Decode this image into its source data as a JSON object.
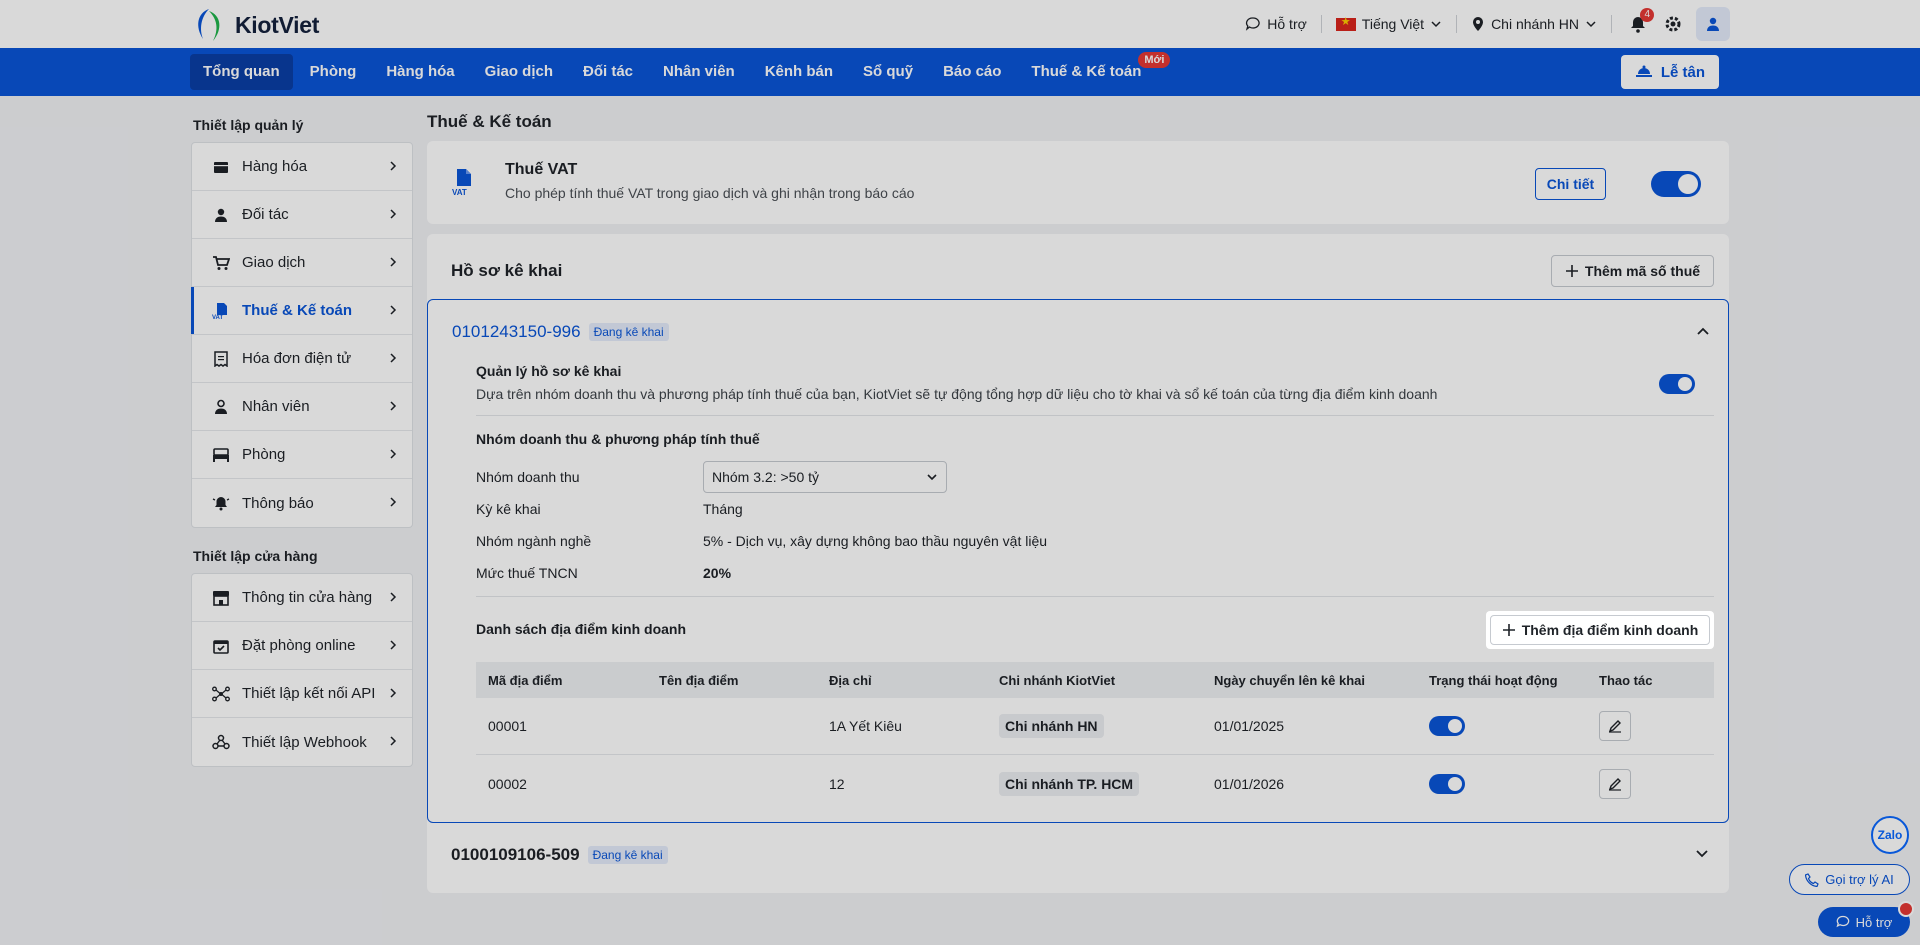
{
  "brand": {
    "name": "KiotViet"
  },
  "topbar": {
    "help": "Hỗ trợ",
    "language": "Tiếng Việt",
    "branch": "Chi nhánh HN",
    "notifications": "4"
  },
  "nav": {
    "items": [
      {
        "label": "Tổng quan",
        "active": true
      },
      {
        "label": "Phòng"
      },
      {
        "label": "Hàng hóa"
      },
      {
        "label": "Giao dịch"
      },
      {
        "label": "Đối tác"
      },
      {
        "label": "Nhân viên"
      },
      {
        "label": "Kênh bán"
      },
      {
        "label": "Sổ quỹ"
      },
      {
        "label": "Báo cáo"
      },
      {
        "label": "Thuế & Kế toán",
        "badge": "Mới"
      }
    ],
    "reception": "Lễ tân"
  },
  "sidebar": {
    "group1_title": "Thiết lập quản lý",
    "group1": [
      {
        "label": "Hàng hóa",
        "icon": "box-icon"
      },
      {
        "label": "Đối tác",
        "icon": "user-icon"
      },
      {
        "label": "Giao dịch",
        "icon": "cart-icon"
      },
      {
        "label": "Thuế & Kế toán",
        "icon": "vat-icon",
        "active": true
      },
      {
        "label": "Hóa đơn điện tử",
        "icon": "invoice-icon"
      },
      {
        "label": "Nhân viên",
        "icon": "staff-icon"
      },
      {
        "label": "Phòng",
        "icon": "bed-icon"
      },
      {
        "label": "Thông báo",
        "icon": "bell-icon"
      }
    ],
    "group2_title": "Thiết lập cửa hàng",
    "group2": [
      {
        "label": "Thông tin cửa hàng",
        "icon": "store-icon"
      },
      {
        "label": "Đặt phòng online",
        "icon": "calendar-icon"
      },
      {
        "label": "Thiết lập kết nối API",
        "icon": "api-icon"
      },
      {
        "label": "Thiết lập Webhook",
        "icon": "webhook-icon"
      }
    ]
  },
  "main": {
    "title": "Thuế & Kế toán",
    "vat": {
      "title": "Thuế VAT",
      "desc": "Cho phép tính thuế VAT trong giao dịch và ghi nhận trong báo cáo",
      "detail_btn": "Chi tiết",
      "icon_text": "VAT",
      "enabled": true
    },
    "declaration": {
      "title": "Hồ sơ kê khai",
      "add_tax_btn": "Thêm mã số thuế",
      "profile1": {
        "code": "0101243150-996",
        "status": "Đang kê khai",
        "manage_title": "Quản lý hồ sơ kê khai",
        "manage_desc": "Dựa trên nhóm doanh thu và phương pháp tính thuế của bạn, KiotViet sẽ tự động tổng hợp dữ liệu cho tờ khai và sổ kế toán của từng địa điểm kinh doanh",
        "section_title": "Nhóm doanh thu & phương pháp tính thuế",
        "fields": {
          "revenue_group_label": "Nhóm doanh thu",
          "revenue_group_value": "Nhóm 3.2: >50 tỷ",
          "period_label": "Kỳ kê khai",
          "period_value": "Tháng",
          "industry_label": "Nhóm ngành nghề",
          "industry_value": "5% - Dịch vụ, xây dựng không bao thầu nguyên vật liệu",
          "pit_label": "Mức thuế TNCN",
          "pit_value": "20%"
        },
        "locations_title": "Danh sách địa điểm kinh doanh",
        "add_location_btn": "Thêm địa điểm kinh doanh",
        "table": {
          "headers": [
            "Mã địa điểm",
            "Tên địa điểm",
            "Địa chỉ",
            "Chi nhánh KiotViet",
            "Ngày chuyển lên kê khai",
            "Trạng thái hoạt động",
            "Thao tác"
          ],
          "rows": [
            {
              "code": "00001",
              "name": "",
              "address": "1A Yết Kiêu",
              "branch": "Chi nhánh HN",
              "date": "01/01/2025",
              "active": true
            },
            {
              "code": "00002",
              "name": "",
              "address": "12",
              "branch": "Chi nhánh TP. HCM",
              "date": "01/01/2026",
              "active": true
            }
          ]
        }
      },
      "profile2": {
        "code": "0100109106-509",
        "status": "Đang kê khai"
      }
    }
  },
  "floating": {
    "zalo": "Zalo",
    "ai": "Gọi trợ lý AI",
    "help": "Hỗ trợ"
  }
}
